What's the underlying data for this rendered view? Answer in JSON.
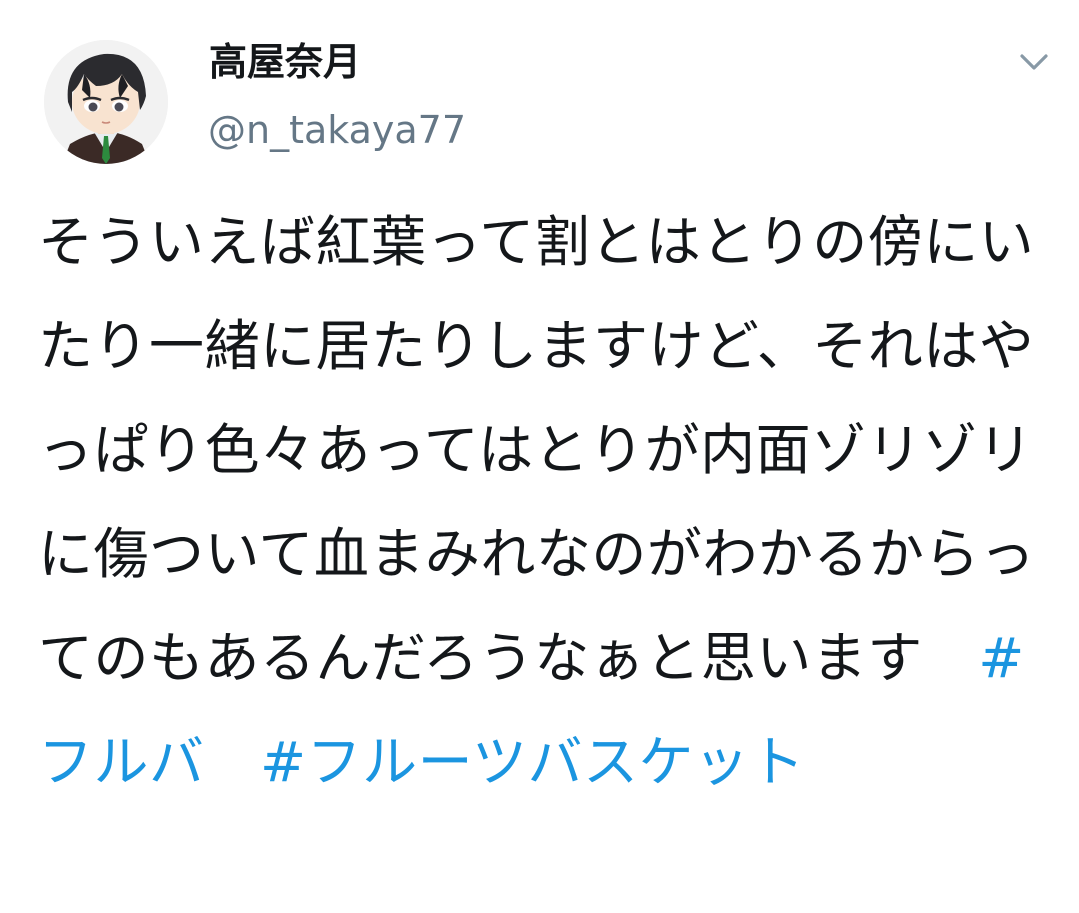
{
  "tweet": {
    "display_name": "高屋奈月",
    "handle": "@n_takaya77",
    "text": "そういえば紅葉って割とはとりの傍にいたり一緒に居たりしますけど、それはやっぱり色々あってはとりが内面ゾリゾリに傷ついて血まみれなのがわかるからってのもあるんだろうなぁと思います　",
    "hashtags": [
      "#フルバ",
      "#フルーツバスケット"
    ],
    "hashtag_separator": "　",
    "avatar_icon": "avatar-illustration",
    "menu_icon": "chevron-down-icon"
  },
  "colors": {
    "text": "#14171a",
    "secondary": "#657786",
    "link": "#1b95e0",
    "caret": "#8899a6"
  }
}
